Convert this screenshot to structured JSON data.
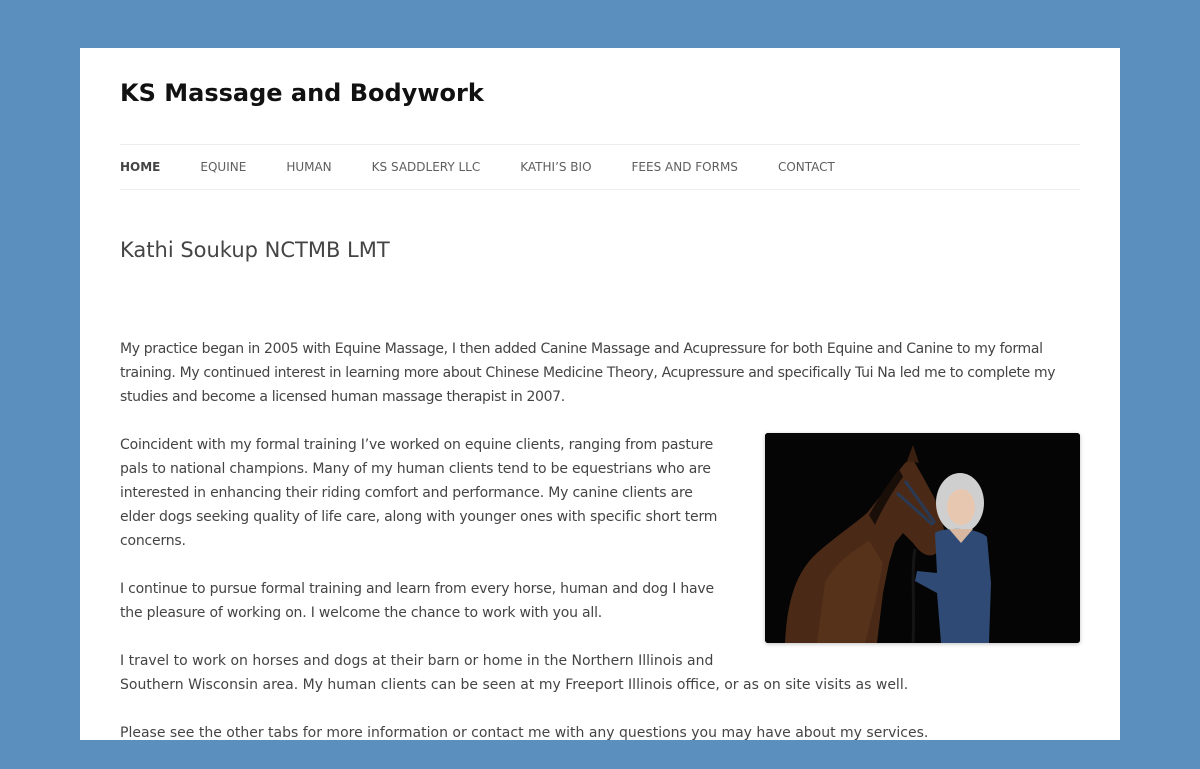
{
  "site": {
    "title": "KS Massage and Bodywork"
  },
  "nav": {
    "items": [
      {
        "label": "HOME"
      },
      {
        "label": "EQUINE"
      },
      {
        "label": "HUMAN"
      },
      {
        "label": "KS SADDLERY LLC"
      },
      {
        "label": "KATHI’S BIO"
      },
      {
        "label": "FEES AND FORMS"
      },
      {
        "label": "CONTACT"
      }
    ]
  },
  "page": {
    "title": "Kathi Soukup NCTMB LMT",
    "paragraphs": [
      "My practice began in 2005 with Equine Massage,  I then added Canine Massage and Acupressure for both Equine and Canine to my formal training. My continued interest in learning more about Chinese Medicine Theory, Acupressure and specifically Tui Na led me to complete my studies and become a licensed human massage therapist in 2007.",
      "Coincident with my formal training I’ve worked on equine clients, ranging from pasture pals to national champions. Many of my human clients tend to be equestrians who are interested in enhancing their riding comfort and performance.  My canine clients are elder dogs seeking quality of life care,  along with younger ones with specific short term concerns.",
      "I continue to pursue formal training and learn from every horse, human and dog I have the pleasure of working on. I welcome the chance to work with you all.",
      "I travel to work on horses and dogs at their barn or home in the Northern Illinois and Southern Wisconsin area.  My human clients can be seen at my Freeport Illinois office, or as on site visits as well.",
      "Please see the other tabs for more information or contact me with any questions you may have about my services."
    ]
  },
  "colors": {
    "background": "#5b8fbe",
    "page": "#ffffff",
    "text": "#444444",
    "title": "#111111"
  }
}
